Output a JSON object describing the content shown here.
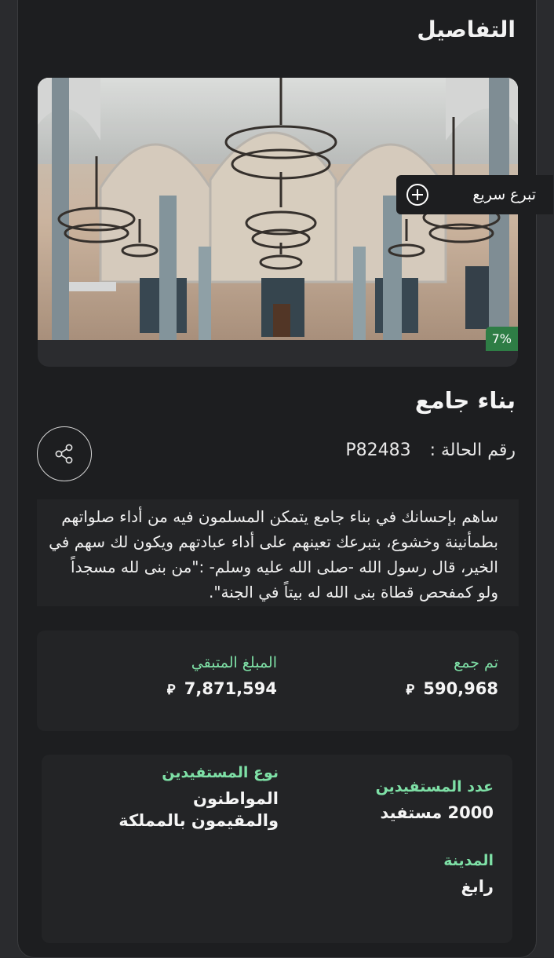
{
  "details_title": "التفاصيل",
  "quick_donate": {
    "label": "تبرع سريع",
    "icon": "plus-circle-icon"
  },
  "progress_badge": "7%",
  "progress_percent": 7,
  "project": {
    "title": "بناء جامع",
    "case_label": "رقم الحالة :",
    "case_number": "P82483",
    "share_icon": "share-icon",
    "description": "ساهم بإحسانك في بناء جامع يتمكن المسلمون فيه من أداء صلواتهم بطمأنينة وخشوع، بتبرعك تعينهم على أداء عبادتهم ويكون لك سهم في الخير، قال رسول الله -صلى الله عليه وسلم- :\"من بنى لله مسجداً ولو كمفحص قطاة بنى الله له بيتاً في الجنة\"."
  },
  "amounts": {
    "collected_label": "تم جمع",
    "collected_value": "590,968",
    "remaining_label": "المبلغ المتبقي",
    "remaining_value": "7,871,594",
    "currency_icon": "riyal-icon"
  },
  "beneficiaries": {
    "count_label": "عدد المستفيدين",
    "count_value": "2000 مستفيد",
    "type_label": "نوع المستفيدين",
    "type_value": "المواطنون والمقيمون بالمملكة",
    "city_label": "المدينة",
    "city_value": "رابغ"
  },
  "colors": {
    "accent_green": "#7ee0a6",
    "badge_green": "#2e7d45",
    "card_bg": "#1d1e20"
  }
}
